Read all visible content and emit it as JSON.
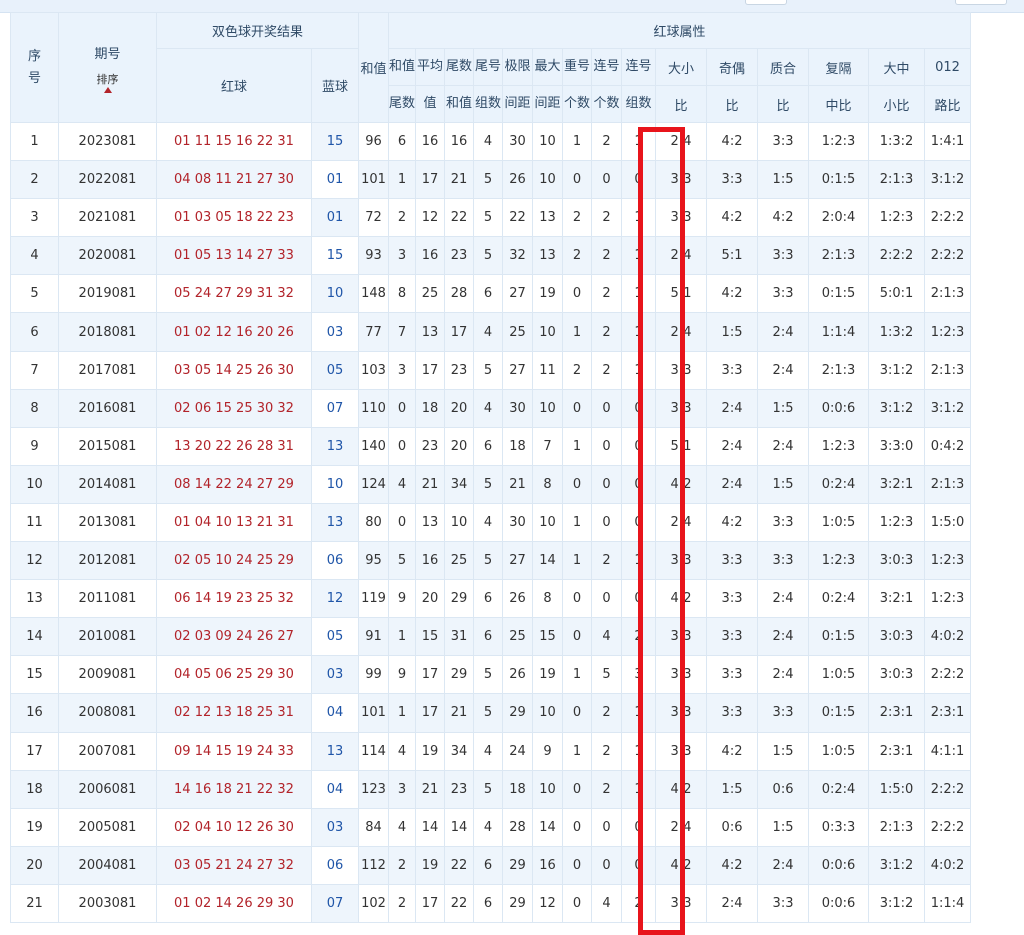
{
  "header": {
    "seq": "序\n号",
    "issue": "期号",
    "sort_label": "排序",
    "result_group": "双色球开奖结果",
    "red_ball": "红球",
    "blue_ball": "蓝球",
    "sum": "和值",
    "attr_group": "红球属性",
    "sub_cols": [
      [
        "和值",
        "尾数"
      ],
      [
        "平均",
        "值"
      ],
      [
        "尾数",
        "和值"
      ],
      [
        "尾号",
        "组数"
      ],
      [
        "极限",
        "间距"
      ],
      [
        "最大",
        "间距"
      ],
      [
        "重号",
        "个数"
      ],
      [
        "连号",
        "个数"
      ],
      [
        "连号",
        "组数"
      ],
      [
        "大小",
        "比"
      ],
      [
        "奇偶",
        "比"
      ],
      [
        "质合",
        "比"
      ],
      [
        "复隔",
        "中比"
      ],
      [
        "大中",
        "小比"
      ],
      [
        "012",
        "路比"
      ]
    ]
  },
  "rows": [
    [
      "1",
      "2023081",
      "01 11 15 16 22 31",
      "15",
      "96",
      "6",
      "16",
      "16",
      "4",
      "30",
      "10",
      "1",
      "2",
      "1",
      "2:4",
      "4:2",
      "3:3",
      "1:2:3",
      "1:3:2",
      "1:4:1"
    ],
    [
      "2",
      "2022081",
      "04 08 11 21 27 30",
      "01",
      "101",
      "1",
      "17",
      "21",
      "5",
      "26",
      "10",
      "0",
      "0",
      "0",
      "3:3",
      "3:3",
      "1:5",
      "0:1:5",
      "2:1:3",
      "3:1:2"
    ],
    [
      "3",
      "2021081",
      "01 03 05 18 22 23",
      "01",
      "72",
      "2",
      "12",
      "22",
      "5",
      "22",
      "13",
      "2",
      "2",
      "1",
      "3:3",
      "4:2",
      "4:2",
      "2:0:4",
      "1:2:3",
      "2:2:2"
    ],
    [
      "4",
      "2020081",
      "01 05 13 14 27 33",
      "15",
      "93",
      "3",
      "16",
      "23",
      "5",
      "32",
      "13",
      "2",
      "2",
      "1",
      "2:4",
      "5:1",
      "3:3",
      "2:1:3",
      "2:2:2",
      "2:2:2"
    ],
    [
      "5",
      "2019081",
      "05 24 27 29 31 32",
      "10",
      "148",
      "8",
      "25",
      "28",
      "6",
      "27",
      "19",
      "0",
      "2",
      "1",
      "5:1",
      "4:2",
      "3:3",
      "0:1:5",
      "5:0:1",
      "2:1:3"
    ],
    [
      "6",
      "2018081",
      "01 02 12 16 20 26",
      "03",
      "77",
      "7",
      "13",
      "17",
      "4",
      "25",
      "10",
      "1",
      "2",
      "1",
      "2:4",
      "1:5",
      "2:4",
      "1:1:4",
      "1:3:2",
      "1:2:3"
    ],
    [
      "7",
      "2017081",
      "03 05 14 25 26 30",
      "05",
      "103",
      "3",
      "17",
      "23",
      "5",
      "27",
      "11",
      "2",
      "2",
      "1",
      "3:3",
      "3:3",
      "2:4",
      "2:1:3",
      "3:1:2",
      "2:1:3"
    ],
    [
      "8",
      "2016081",
      "02 06 15 25 30 32",
      "07",
      "110",
      "0",
      "18",
      "20",
      "4",
      "30",
      "10",
      "0",
      "0",
      "0",
      "3:3",
      "2:4",
      "1:5",
      "0:0:6",
      "3:1:2",
      "3:1:2"
    ],
    [
      "9",
      "2015081",
      "13 20 22 26 28 31",
      "13",
      "140",
      "0",
      "23",
      "20",
      "6",
      "18",
      "7",
      "1",
      "0",
      "0",
      "5:1",
      "2:4",
      "2:4",
      "1:2:3",
      "3:3:0",
      "0:4:2"
    ],
    [
      "10",
      "2014081",
      "08 14 22 24 27 29",
      "10",
      "124",
      "4",
      "21",
      "34",
      "5",
      "21",
      "8",
      "0",
      "0",
      "0",
      "4:2",
      "2:4",
      "1:5",
      "0:2:4",
      "3:2:1",
      "2:1:3"
    ],
    [
      "11",
      "2013081",
      "01 04 10 13 21 31",
      "13",
      "80",
      "0",
      "13",
      "10",
      "4",
      "30",
      "10",
      "1",
      "0",
      "0",
      "2:4",
      "4:2",
      "3:3",
      "1:0:5",
      "1:2:3",
      "1:5:0"
    ],
    [
      "12",
      "2012081",
      "02 05 10 24 25 29",
      "06",
      "95",
      "5",
      "16",
      "25",
      "5",
      "27",
      "14",
      "1",
      "2",
      "1",
      "3:3",
      "3:3",
      "3:3",
      "1:2:3",
      "3:0:3",
      "1:2:3"
    ],
    [
      "13",
      "2011081",
      "06 14 19 23 25 32",
      "12",
      "119",
      "9",
      "20",
      "29",
      "6",
      "26",
      "8",
      "0",
      "0",
      "0",
      "4:2",
      "3:3",
      "2:4",
      "0:2:4",
      "3:2:1",
      "1:2:3"
    ],
    [
      "14",
      "2010081",
      "02 03 09 24 26 27",
      "05",
      "91",
      "1",
      "15",
      "31",
      "6",
      "25",
      "15",
      "0",
      "4",
      "2",
      "3:3",
      "3:3",
      "2:4",
      "0:1:5",
      "3:0:3",
      "4:0:2"
    ],
    [
      "15",
      "2009081",
      "04 05 06 25 29 30",
      "03",
      "99",
      "9",
      "17",
      "29",
      "5",
      "26",
      "19",
      "1",
      "5",
      "3",
      "3:3",
      "3:3",
      "2:4",
      "1:0:5",
      "3:0:3",
      "2:2:2"
    ],
    [
      "16",
      "2008081",
      "02 12 13 18 25 31",
      "04",
      "101",
      "1",
      "17",
      "21",
      "5",
      "29",
      "10",
      "0",
      "2",
      "1",
      "3:3",
      "3:3",
      "3:3",
      "0:1:5",
      "2:3:1",
      "2:3:1"
    ],
    [
      "17",
      "2007081",
      "09 14 15 19 24 33",
      "13",
      "114",
      "4",
      "19",
      "34",
      "4",
      "24",
      "9",
      "1",
      "2",
      "1",
      "3:3",
      "4:2",
      "1:5",
      "1:0:5",
      "2:3:1",
      "4:1:1"
    ],
    [
      "18",
      "2006081",
      "14 16 18 21 22 32",
      "04",
      "123",
      "3",
      "21",
      "23",
      "5",
      "18",
      "10",
      "0",
      "2",
      "1",
      "4:2",
      "1:5",
      "0:6",
      "0:2:4",
      "1:5:0",
      "2:2:2"
    ],
    [
      "19",
      "2005081",
      "02 04 10 12 26 30",
      "03",
      "84",
      "4",
      "14",
      "14",
      "4",
      "28",
      "14",
      "0",
      "0",
      "0",
      "2:4",
      "0:6",
      "1:5",
      "0:3:3",
      "2:1:3",
      "2:2:2"
    ],
    [
      "20",
      "2004081",
      "03 05 21 24 27 32",
      "06",
      "112",
      "2",
      "19",
      "22",
      "6",
      "29",
      "16",
      "0",
      "0",
      "0",
      "4:2",
      "4:2",
      "2:4",
      "0:0:6",
      "3:1:2",
      "4:0:2"
    ],
    [
      "21",
      "2003081",
      "01 02 14 26 29 30",
      "07",
      "102",
      "2",
      "17",
      "22",
      "6",
      "29",
      "12",
      "0",
      "4",
      "2",
      "3:3",
      "2:4",
      "3:3",
      "0:0:6",
      "3:1:2",
      "1:1:4"
    ]
  ],
  "colors": {
    "red_ball": "#b2232a",
    "blue_ball": "#1f55a8",
    "highlight": "#e8141b",
    "header_bg": "#eaf3fc",
    "stripe": "#eef5fc"
  }
}
